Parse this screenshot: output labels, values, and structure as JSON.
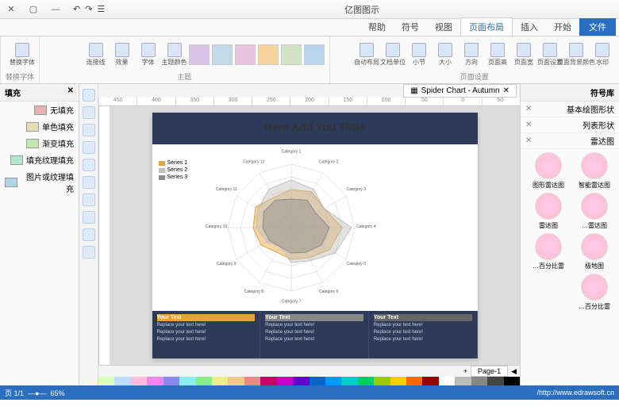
{
  "app": {
    "title": "亿图图示"
  },
  "qat": [
    "↶",
    "↷",
    "☰"
  ],
  "ribbon_tabs": [
    "文件",
    "开始",
    "插入",
    "页面布局",
    "视图",
    "符号",
    "帮助"
  ],
  "ribbon_groups": {
    "grp1": {
      "label": "替换字体",
      "btns": [
        "替换字体"
      ]
    },
    "grp2": {
      "label": "主题",
      "btns": [
        "主题颜色",
        "字体",
        "效果",
        "连接线",
        "主题"
      ]
    },
    "grp3": {
      "label": "页面设置",
      "btns": [
        "水印",
        "页面背景颜色",
        "页面设置",
        "页面宽",
        "页面高",
        "方向",
        "大小",
        "小节",
        "文档单位",
        "自动布局"
      ]
    }
  },
  "themes": [
    "#b9d4ef",
    "#cfe4c4",
    "#f5d49b",
    "#e8c4df",
    "#c4d9e8",
    "#d9c4e8"
  ],
  "right_panel": {
    "title": "符号库",
    "cats": [
      "基本绘图形状",
      "列表形状",
      "雷达图"
    ],
    "items": [
      "智能雷达图",
      "图形雷达图",
      "雷达图…",
      "雷达图",
      "极地图",
      "百分比雷…",
      "百分比雷…"
    ]
  },
  "left_panel": {
    "title": "填充",
    "rows": [
      "无填充",
      "单色填充",
      "渐变填充",
      "填充纹理填充",
      "图片或纹理填充"
    ]
  },
  "doc_tab": "Spider Chart - Autumn",
  "ruler_marks": [
    "-50",
    "0",
    "50",
    "100",
    "150",
    "200",
    "250",
    "300",
    "350",
    "400",
    "450"
  ],
  "chart_page": {
    "title": "Here Add You Tittle",
    "legend": [
      "Series 1",
      "Series 2",
      "Series 3"
    ],
    "legend_colors": [
      "#e6a23c",
      "#bfbfbf",
      "#8c8c8c"
    ],
    "footers": [
      {
        "h": "Your Text",
        "lines": [
          "Replace your text here!",
          "Replace your text here!",
          "Replace your text here!"
        ]
      },
      {
        "h": "Your Text",
        "lines": [
          "Replace your text here!",
          "Replace your text here!",
          "Replace your text here!"
        ]
      },
      {
        "h": "Your Text",
        "lines": [
          "Replace your text here!",
          "Replace your text here!",
          "Replace your text here!"
        ]
      }
    ]
  },
  "chart_data": {
    "type": "radar",
    "categories": [
      "Category 1",
      "Category 2",
      "Category 3",
      "Category 4",
      "Category 5",
      "Category 6",
      "Category 7",
      "Category 8",
      "Category 9",
      "Category 10",
      "Category 11",
      "Category 12"
    ],
    "rlim": [
      0,
      100
    ],
    "series": [
      {
        "name": "Series 1",
        "color": "#e6a23c",
        "values": [
          60,
          65,
          60,
          80,
          70,
          55,
          50,
          45,
          55,
          60,
          65,
          55
        ]
      },
      {
        "name": "Series 2",
        "color": "#bfbfbf",
        "values": [
          75,
          70,
          60,
          95,
          80,
          60,
          55,
          35,
          45,
          55,
          60,
          70
        ]
      },
      {
        "name": "Series 3",
        "color": "#8c8c8c",
        "values": [
          45,
          50,
          45,
          60,
          55,
          45,
          40,
          35,
          40,
          45,
          50,
          50
        ]
      }
    ]
  },
  "page_tab": "Page-1",
  "status": {
    "left": "页 1/1",
    "zoom": "65%",
    "right": "http://www.edrawsoft.cn/"
  },
  "palette": [
    "#000",
    "#444",
    "#888",
    "#bbb",
    "#fff",
    "#900",
    "#f60",
    "#fc0",
    "#9c0",
    "#0c6",
    "#0cc",
    "#09f",
    "#06c",
    "#60c",
    "#c0c",
    "#c06",
    "#e88",
    "#ec8",
    "#ee8",
    "#8e8",
    "#8ee",
    "#88e",
    "#e8e",
    "#fbd",
    "#bdf",
    "#dfb"
  ]
}
